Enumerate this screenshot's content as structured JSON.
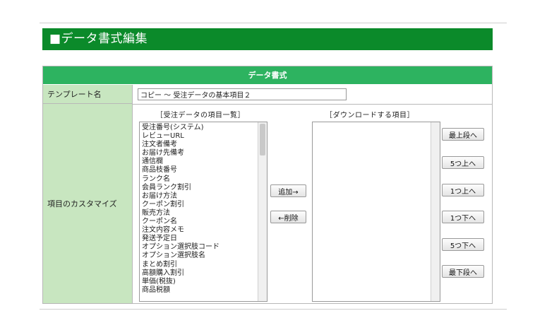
{
  "page": {
    "title": "■データ書式編集"
  },
  "table": {
    "header": "データ書式",
    "template_label": "テンプレート名",
    "template_value": "コピー ～ 受注データの基本項目２",
    "customize_label": "項目のカスタマイズ"
  },
  "lists": {
    "available_caption": "［受注データの項目一覧］",
    "selected_caption": "［ダウンロードする項目］",
    "available_items": [
      "受注番号(システム)",
      "レビューURL",
      "注文者備考",
      "お届け先備考",
      "通信欄",
      "商品枝番号",
      "ランク名",
      "会員ランク割引",
      "お届け方法",
      "クーポン割引",
      "販売方法",
      "クーポン名",
      "注文内容メモ",
      "発送予定日",
      "オプション選択肢コード",
      "オプション選択肢名",
      "まとめ割引",
      "高額購入割引",
      "単価(税抜)",
      "商品税額"
    ],
    "selected_items": []
  },
  "buttons": {
    "add": "追加→",
    "remove": "←削除",
    "move_top": "最上段へ",
    "move_up5": "5つ上へ",
    "move_up1": "1つ上へ",
    "move_down1": "1つ下へ",
    "move_down5": "5つ下へ",
    "move_bottom": "最下段へ"
  },
  "colors": {
    "title_bar": "#0b8a2a",
    "table_header": "#2db360",
    "label_cell": "#c8e6c0"
  }
}
